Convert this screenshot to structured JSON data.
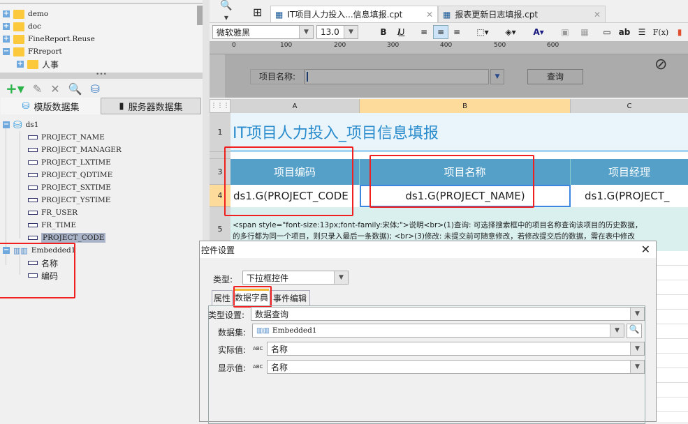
{
  "file_tree": [
    {
      "label": "demo",
      "expanded": false
    },
    {
      "label": "doc",
      "expanded": false
    },
    {
      "label": "FineReport.Reuse",
      "expanded": false
    },
    {
      "label": "FRreport",
      "expanded": true
    },
    {
      "label": "人事",
      "expanded": false
    }
  ],
  "dataset_tabs": [
    "模版数据集",
    "服务器数据集"
  ],
  "datasets": {
    "ds1": {
      "name": "ds1",
      "fields": [
        "PROJECT_NAME",
        "PROJECT_MANAGER",
        "PROJECT_LXTIME",
        "PROJECT_QDTIME",
        "PROJECT_SXTIME",
        "PROJECT_YSTIME",
        "FR_USER",
        "FR_TIME",
        "PROJECT_CODE"
      ],
      "selected": "PROJECT_CODE"
    },
    "embedded": {
      "name": "Embedded1",
      "fields": [
        "名称",
        "编码"
      ]
    }
  },
  "editor_tabs": [
    "IT项目人力投入...信息填报.cpt",
    "报表更新日志填报.cpt"
  ],
  "format": {
    "font": "微软雅黑",
    "size": "13.0",
    "bold": "B",
    "italic": "I",
    "underline": "U",
    "fx": "F(x)",
    "ab": "ab"
  },
  "ruler": [
    "0",
    "100",
    "200",
    "300",
    "400",
    "500",
    "600"
  ],
  "param_panel": {
    "label": "项目名称:",
    "query_button": "查询"
  },
  "columns": [
    "A",
    "B",
    "C"
  ],
  "rows": [
    "1",
    "3",
    "4",
    "5"
  ],
  "sheet": {
    "title": "IT项目人力投入_项目信息填报",
    "headers": [
      "项目编码",
      "项目名称",
      "项目经理"
    ],
    "cells": [
      "ds1.G(PROJECT_CODE",
      "ds1.G(PROJECT_NAME)",
      "ds1.G(PROJECT_"
    ],
    "note1": "<span style=\"font-size:13px;font-family:宋体;\">说明<br>(1)查询: 可选择搜索框中的项目名称查询该项目的历史数据，",
    "note2": "的多行都为同一个项目，则只录入最后一条数据); <br>(3)修改: 未提交前可随意修改，若修改提交后的数据，需在表中修改"
  },
  "dialog": {
    "title": "控件设置",
    "type_label": "类型:",
    "type_value": "下拉框控件",
    "tabs": [
      "属性",
      "数据字典",
      "事件编辑"
    ],
    "active_tab": "数据字典",
    "type_setting_label": "类型设置:",
    "type_setting_value": "数据查询",
    "dataset_label": "数据集:",
    "dataset_value": "Embedded1",
    "actual_label": "实际值:",
    "actual_value": "名称",
    "display_label": "显示值:",
    "display_value": "名称",
    "abc": "ABC"
  },
  "colors": {
    "header_blue": "#55a0c8",
    "title_blue": "#2a8ccc",
    "highlight": "#f02020"
  }
}
